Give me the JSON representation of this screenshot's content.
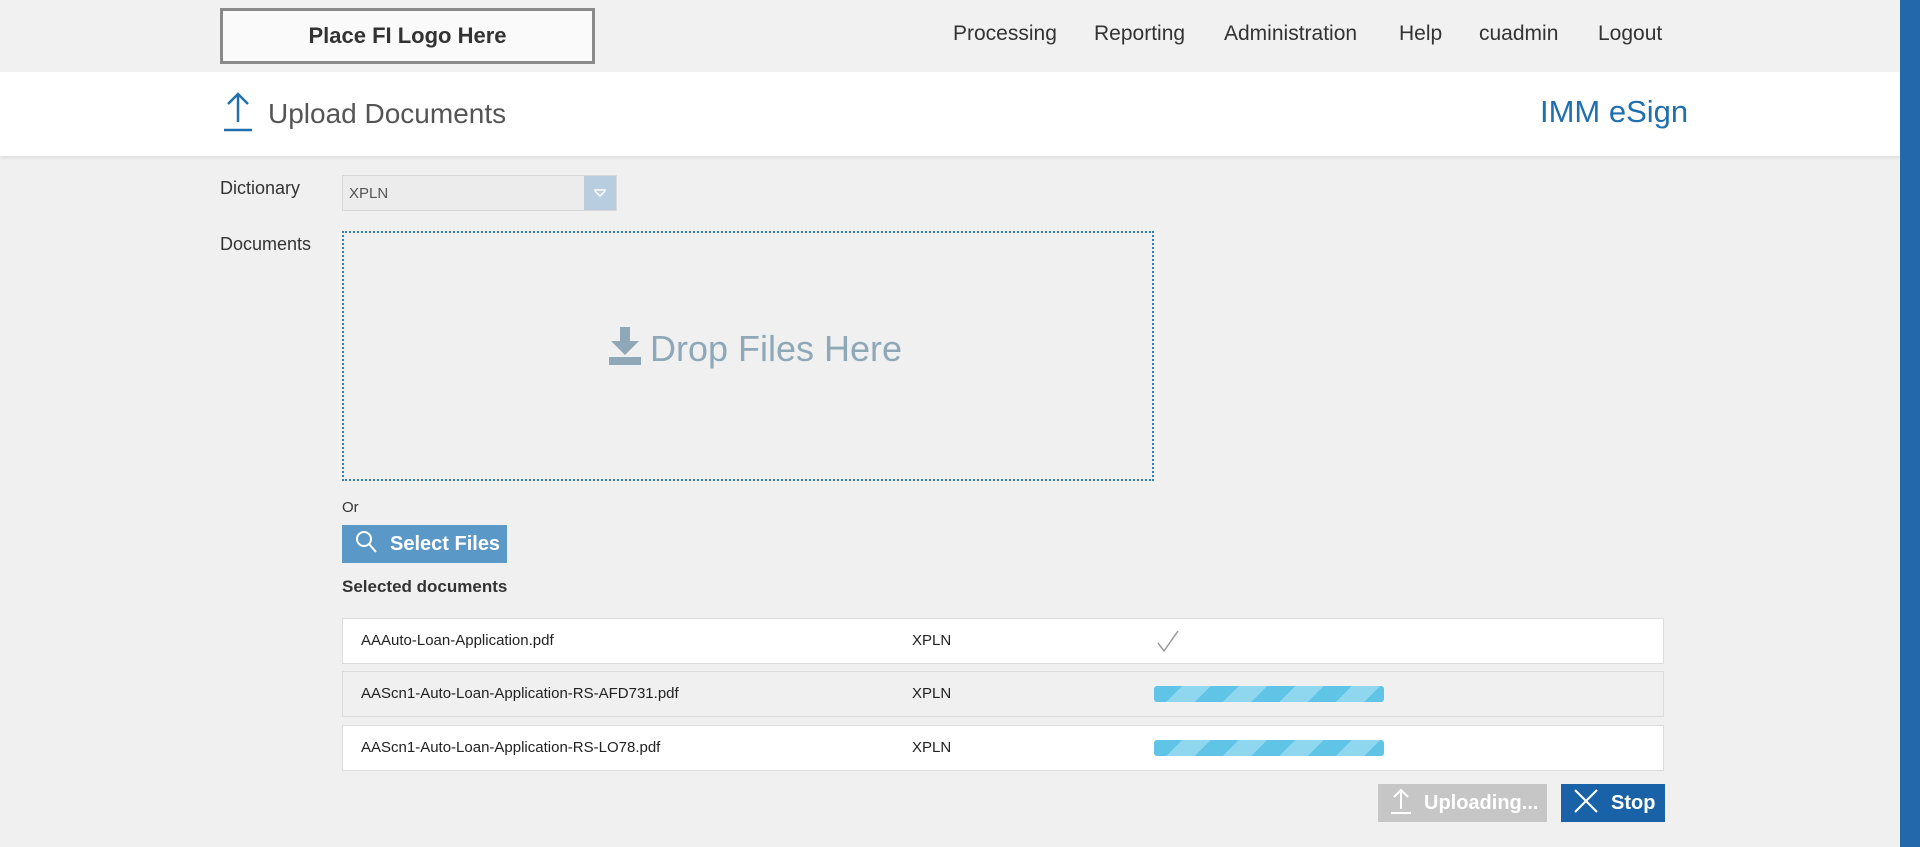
{
  "header": {
    "logo_text": "Place FI Logo Here",
    "nav": [
      "Processing",
      "Reporting",
      "Administration",
      "Help",
      "cuadmin",
      "Logout"
    ]
  },
  "title_band": {
    "page_title": "Upload Documents",
    "brand": "IMM eSign"
  },
  "form": {
    "dictionary_label": "Dictionary",
    "dictionary_value": "XPLN",
    "documents_label": "Documents",
    "drop_text": "Drop Files Here",
    "or_text": "Or",
    "select_files_label": "Select Files"
  },
  "selected": {
    "title": "Selected documents",
    "rows": [
      {
        "name": "AAAuto-Loan-Application.pdf",
        "dictionary": "XPLN",
        "status": "done"
      },
      {
        "name": "AAScn1-Auto-Loan-Application-RS-AFD731.pdf",
        "dictionary": "XPLN",
        "status": "uploading"
      },
      {
        "name": "AAScn1-Auto-Loan-Application-RS-LO78.pdf",
        "dictionary": "XPLN",
        "status": "uploading"
      }
    ]
  },
  "actions": {
    "uploading_label": "Uploading...",
    "stop_label": "Stop"
  },
  "colors": {
    "brand": "#2070b0",
    "stop_button": "#1a62a8",
    "select_button": "#5a98c8",
    "progress": "#5fc4e6"
  }
}
